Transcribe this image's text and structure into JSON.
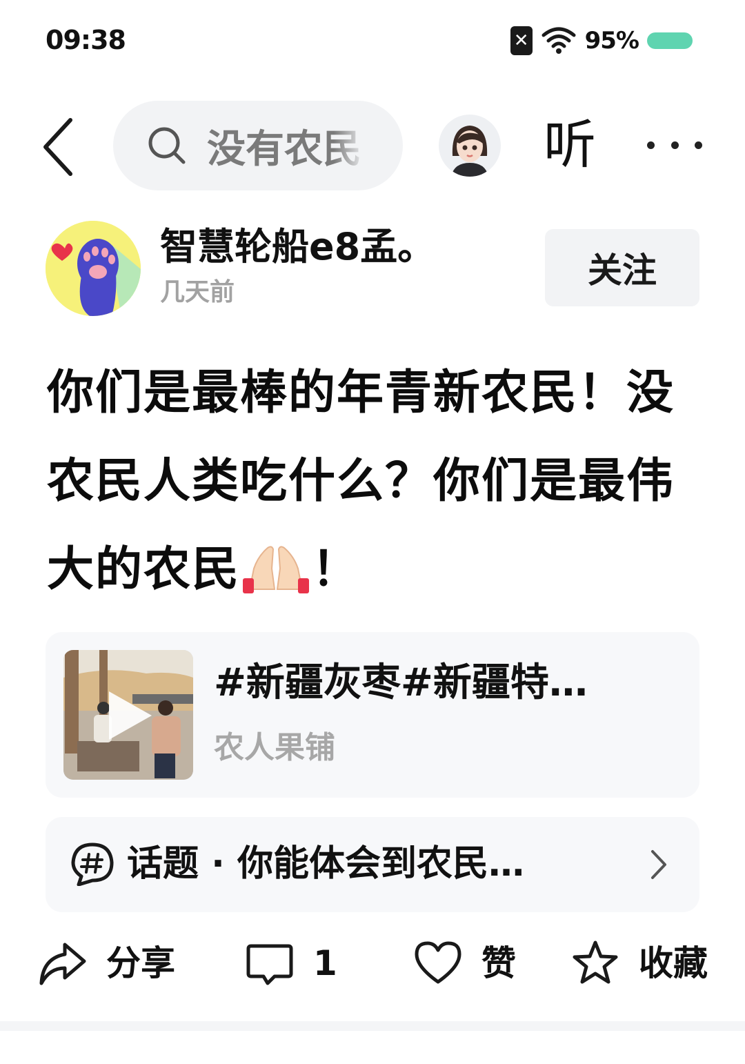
{
  "status_bar": {
    "time": "09:38",
    "battery_percent": "95%",
    "battery_level": 0.95,
    "icons": [
      "sim-off-icon",
      "wifi-icon",
      "battery-icon"
    ]
  },
  "top_nav": {
    "search_query": "没有农民",
    "listen_label": "听",
    "icons": [
      "back-icon",
      "search-icon",
      "ai-avatar-icon",
      "more-icon"
    ]
  },
  "post": {
    "author_name": "智慧轮船e8孟。",
    "time": "几天前",
    "follow_label": "关注",
    "body_part1": "你们是最棒的年青新农民！没农民人类吃什么？你们是最伟大的农民",
    "body_part2": "！",
    "emoji_icon": "raised-hands-emoji"
  },
  "video_card": {
    "title": "#新疆灰枣#新疆特…",
    "source": "农人果铺",
    "icon": "play-icon"
  },
  "topic_card": {
    "text": "话题 · 你能体会到农民…",
    "icons": [
      "topic-hash-icon",
      "chevron-right-icon"
    ]
  },
  "actions": {
    "share_label": "分享",
    "comment_count": "1",
    "like_label": "赞",
    "favorite_label": "收藏"
  },
  "colors": {
    "battery": "#5fd4b0",
    "card_bg": "#f7f8fa",
    "search_bg": "#f2f3f5",
    "muted_text": "#a2a2a2"
  }
}
